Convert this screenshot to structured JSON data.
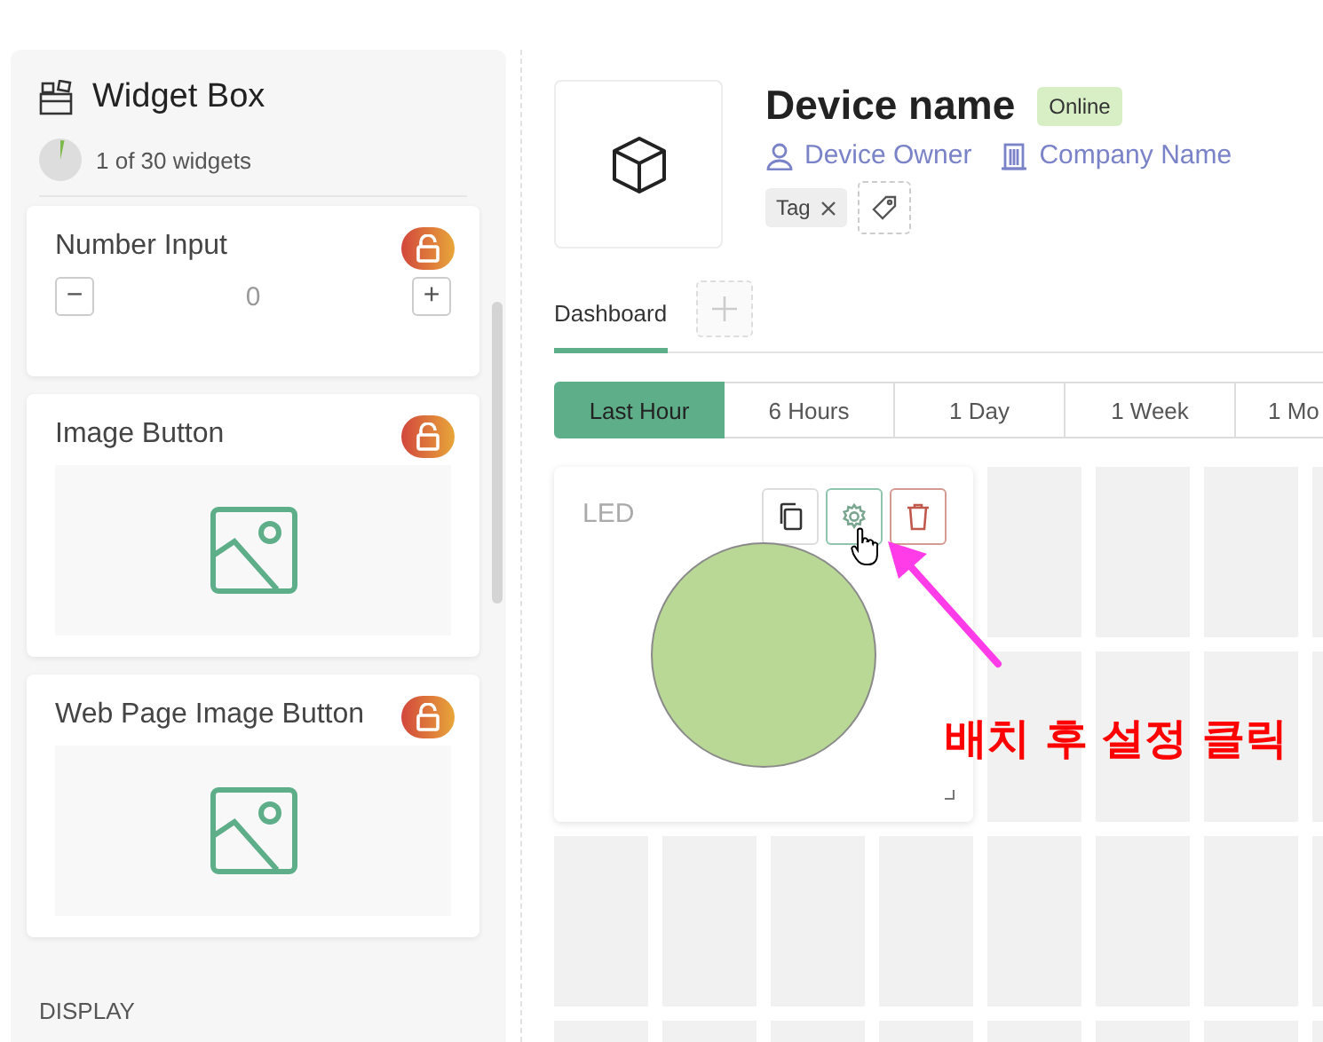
{
  "widget_box": {
    "title": "Widget Box",
    "usage": "1 of 30 widgets",
    "level": 0.033
  },
  "widgets": [
    {
      "kind": "number_input",
      "title": "Number Input",
      "minus": "−",
      "value": "0",
      "plus": "+"
    },
    {
      "kind": "image_button",
      "title": "Image Button"
    },
    {
      "kind": "image_button",
      "title": "Web Page Image Button"
    }
  ],
  "section_label": "DISPLAY",
  "device": {
    "name": "Device name",
    "status": "Online",
    "owner": "Device Owner",
    "company": "Company Name",
    "tags": [
      {
        "label": "Tag"
      }
    ]
  },
  "tabs": [
    {
      "label": "Dashboard",
      "selected": true
    }
  ],
  "time_ranges": [
    {
      "label": "Last Hour",
      "selected": true
    },
    {
      "label": "6 Hours",
      "selected": false
    },
    {
      "label": "1 Day",
      "selected": false
    },
    {
      "label": "1 Week",
      "selected": false
    },
    {
      "label": "1 Mo",
      "selected": false
    }
  ],
  "led_widget": {
    "title": "LED"
  },
  "annotation": {
    "text": "배치 후 설정 클릭"
  }
}
